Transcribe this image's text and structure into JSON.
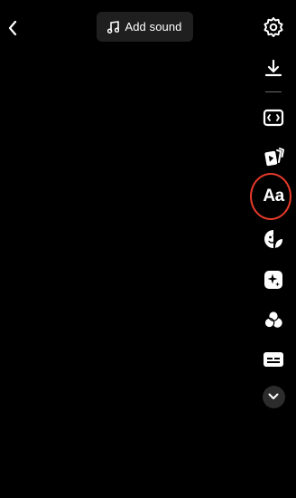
{
  "header": {
    "back": {
      "icon": "chevron-left-icon"
    },
    "add_sound": {
      "label": "Add sound",
      "icon": "music-note-icon"
    }
  },
  "toolbar": {
    "items": [
      {
        "icon": "settings-gear-icon"
      },
      {
        "icon": "download-icon"
      },
      {
        "icon": "resize-frame-icon"
      },
      {
        "icon": "template-cards-icon"
      },
      {
        "icon": "text-icon",
        "label": "Aa",
        "highlighted": true
      },
      {
        "icon": "sticker-icon"
      },
      {
        "icon": "effects-sparkle-icon"
      },
      {
        "icon": "filters-icon"
      },
      {
        "icon": "captions-icon"
      },
      {
        "icon": "chevron-down-icon"
      }
    ]
  },
  "colors": {
    "highlight_ring": "#e53a2a",
    "background": "#000000",
    "pill": "#1f1f1f"
  }
}
